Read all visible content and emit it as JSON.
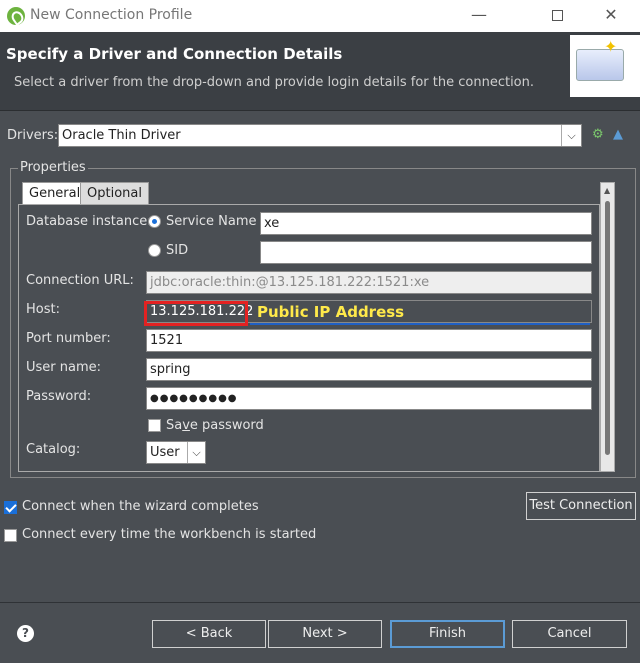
{
  "window": {
    "title": "New Connection Profile"
  },
  "banner": {
    "heading": "Specify a Driver and Connection Details",
    "subtitle": "Select a driver from the drop-down and provide login details for the connection."
  },
  "drivers": {
    "label": "Drivers:",
    "value": "Oracle Thin Driver"
  },
  "properties": {
    "group_title": "Properties",
    "tabs": [
      {
        "label": "General"
      },
      {
        "label": "Optional"
      }
    ],
    "database_instance_label": "Database instance:",
    "service_name_label": "Service Name",
    "service_name_value": "xe",
    "sid_label": "SID",
    "sid_value": "",
    "connection_url_label": "Connection URL:",
    "connection_url_value": "jdbc:oracle:thin:@13.125.181.222:1521:xe",
    "host_label": "Host:",
    "host_value": "13.125.181.222",
    "port_label": "Port number:",
    "port_value": "1521",
    "user_label": "User name:",
    "user_value": "spring",
    "password_label": "Password:",
    "password_mask": "●●●●●●●●●",
    "save_password_pre": "Sa",
    "save_password_mn": "v",
    "save_password_post": "e password",
    "catalog_label": "Catalog:",
    "catalog_value": "User"
  },
  "annotation": {
    "text": "Public IP Address"
  },
  "options": {
    "connect_when_complete": "Connect when the wizard completes",
    "connect_every_time": "Connect every time the workbench is started"
  },
  "buttons": {
    "test_connection": "Test Connection",
    "back": "< Back",
    "next": "Next >",
    "finish": "Finish",
    "cancel": "Cancel"
  },
  "colors": {
    "accent": "#1a6fd9",
    "annotation_box": "#e32222",
    "annotation_text": "#ffe94a"
  }
}
